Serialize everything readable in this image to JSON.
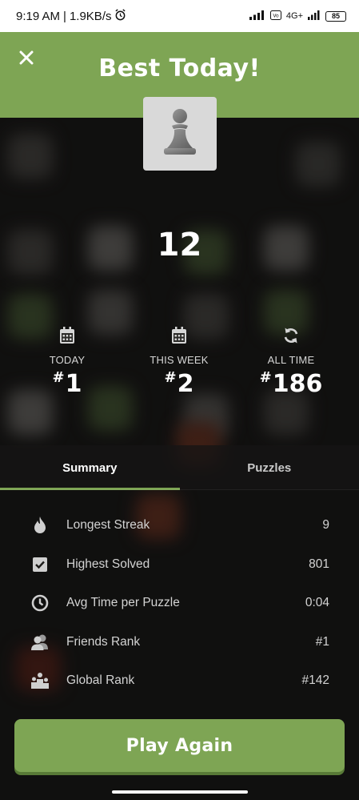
{
  "status_bar": {
    "time": "9:19 AM",
    "speed": "1.9KB/s",
    "network": "4G+",
    "battery": "85"
  },
  "header": {
    "title": "Best Today!"
  },
  "score": "12",
  "stats": [
    {
      "label": "TODAY",
      "hash": "#",
      "value": "1",
      "icon": "calendar-icon"
    },
    {
      "label": "THIS WEEK",
      "hash": "#",
      "value": "2",
      "icon": "calendar-icon"
    },
    {
      "label": "ALL TIME",
      "hash": "#",
      "value": "186",
      "icon": "refresh-icon"
    }
  ],
  "tabs": [
    {
      "label": "Summary",
      "active": true
    },
    {
      "label": "Puzzles",
      "active": false
    }
  ],
  "summary": [
    {
      "label": "Longest Streak",
      "value": "9",
      "icon": "flame-icon"
    },
    {
      "label": "Highest Solved",
      "value": "801",
      "icon": "checkbox-icon"
    },
    {
      "label": "Avg Time per Puzzle",
      "value": "0:04",
      "icon": "clock-icon"
    },
    {
      "label": "Friends Rank",
      "value": "#1",
      "icon": "friends-icon"
    },
    {
      "label": "Global Rank",
      "value": "#142",
      "icon": "podium-icon"
    }
  ],
  "play_button": "Play Again",
  "colors": {
    "accent": "#7ea554",
    "background": "#1b1a18"
  }
}
